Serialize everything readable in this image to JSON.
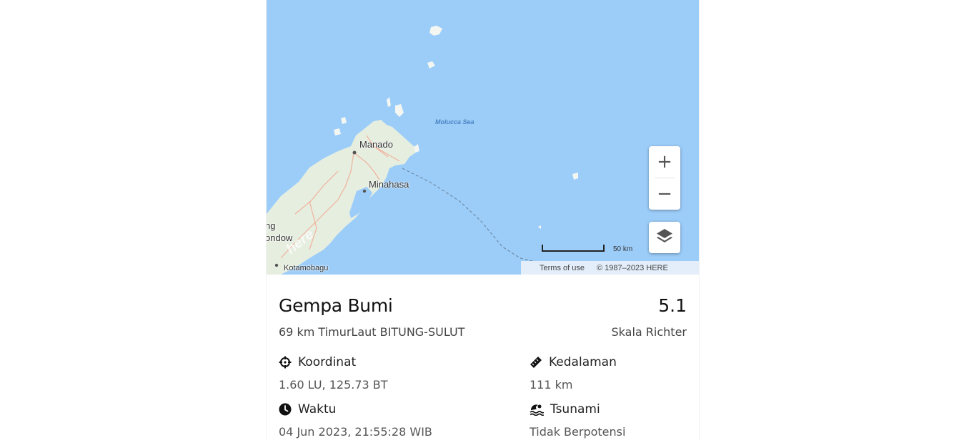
{
  "map": {
    "labels": {
      "sea": "Molucca Sea",
      "manado": "Manado",
      "minahasa": "Minahasa",
      "bolaang": "ng",
      "mongondow": "ondow",
      "kotamobagu": "Kotamobagu",
      "here_logo": "here"
    },
    "scale_label": "50 km",
    "terms": "Terms of use",
    "copyright": "© 1987–2023 HERE",
    "zoom_in": "+",
    "zoom_out": "−",
    "colors": {
      "water": "#9ccdf9",
      "land": "#e8f0e0",
      "roads": "#f2a78f"
    }
  },
  "event": {
    "title": "Gempa Bumi",
    "magnitude": "5.1",
    "location": "69 km TimurLaut BITUNG-SULUT",
    "scale": "Skala Richter",
    "koordinat_label": "Koordinat",
    "koordinat_value": "1.60 LU, 125.73 BT",
    "kedalaman_label": "Kedalaman",
    "kedalaman_value": "111 km",
    "waktu_label": "Waktu",
    "waktu_value": "04 Jun 2023, 21:55:28 WIB",
    "tsunami_label": "Tsunami",
    "tsunami_value": "Tidak Berpotensi"
  },
  "icons": {
    "koordinat": "crosshair-icon",
    "kedalaman": "ruler-icon",
    "waktu": "clock-icon",
    "tsunami": "wave-icon",
    "layers": "layers-icon"
  }
}
